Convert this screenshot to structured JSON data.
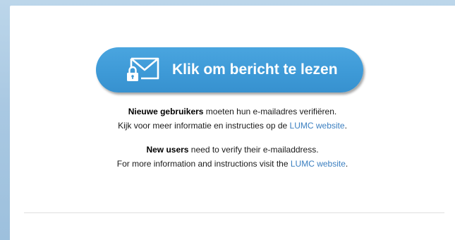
{
  "button": {
    "label": "Klik om bericht te lezen",
    "icon": "envelope-lock-icon",
    "color": "#3e9ad7"
  },
  "dutch": {
    "bold": "Nieuwe gebruikers",
    "line1_rest": " moeten hun e-mailadres verifiëren.",
    "line2_prefix": "Kijk voor meer informatie en instructies op de ",
    "link": "LUMC website",
    "line2_suffix": "."
  },
  "english": {
    "bold": "New users",
    "line1_rest": " need to verify their e-mailaddress.",
    "line2_prefix": "For more information and instructions visit the ",
    "link": "LUMC website",
    "line2_suffix": "."
  },
  "colors": {
    "link": "#3b7fc0",
    "background": "#a9c8e2"
  }
}
